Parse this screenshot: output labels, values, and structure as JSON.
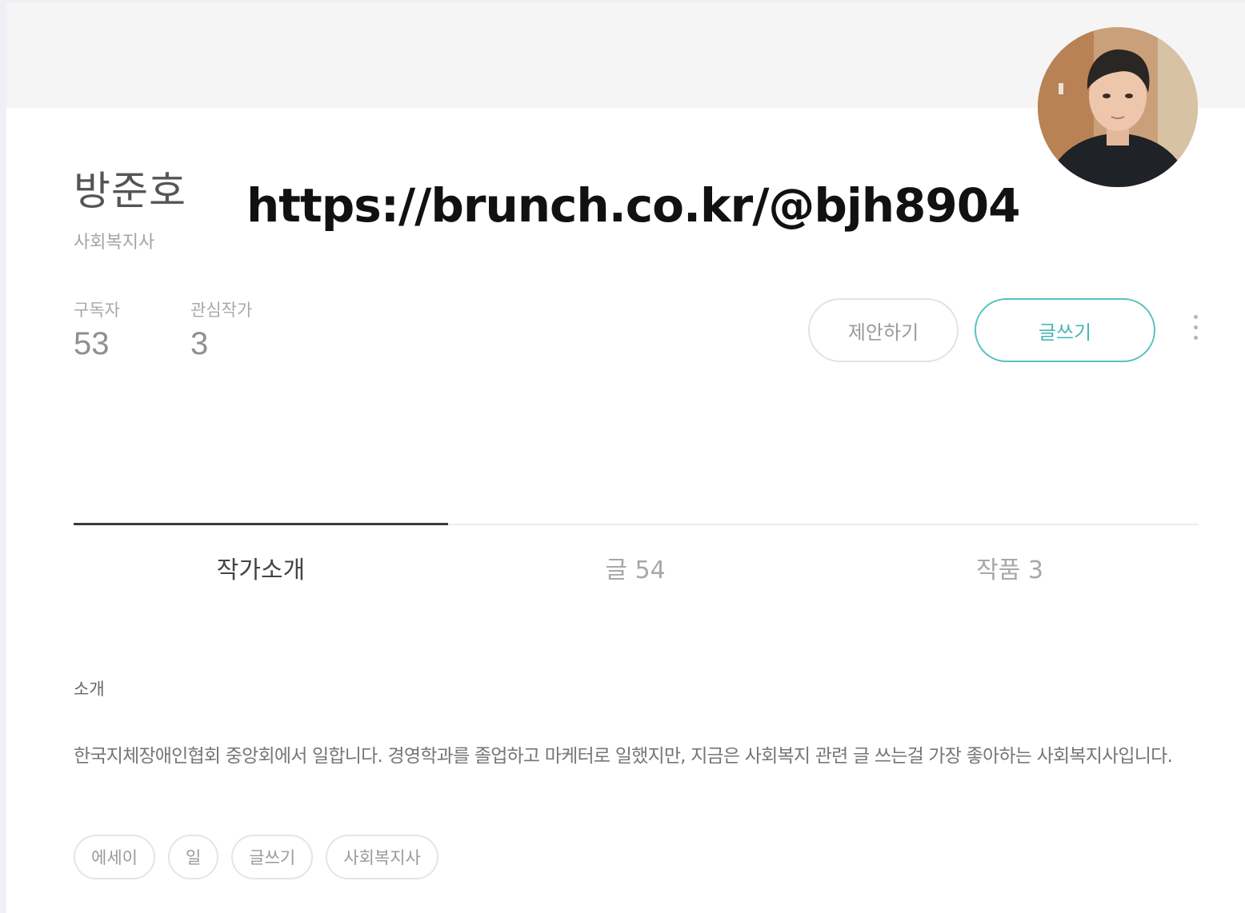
{
  "profile": {
    "name": "방준호",
    "job": "사회복지사",
    "url_overlay": "https://brunch.co.kr/@bjh8904"
  },
  "stats": {
    "subscribers_label": "구독자",
    "subscribers_value": "53",
    "following_label": "관심작가",
    "following_value": "3"
  },
  "actions": {
    "suggest_label": "제안하기",
    "write_label": "글쓰기",
    "more_icon": "more-vertical-icon"
  },
  "tabs": [
    {
      "label": "작가소개",
      "active": true
    },
    {
      "label": "글 54",
      "active": false
    },
    {
      "label": "작품 3",
      "active": false
    }
  ],
  "intro": {
    "section_label": "소개",
    "text": "한국지체장애인협회 중앙회에서 일합니다. 경영학과를 졸업하고 마케터로 일했지만, 지금은 사회복지 관련 글 쓰는걸 가장 좋아하는 사회복지사입니다."
  },
  "keywords": [
    "에세이",
    "일",
    "글쓰기",
    "사회복지사"
  ],
  "colors": {
    "accent": "#47b8b4",
    "cover": "#f5f5f5",
    "text_primary": "#555555",
    "text_muted": "#a8a8a8"
  }
}
